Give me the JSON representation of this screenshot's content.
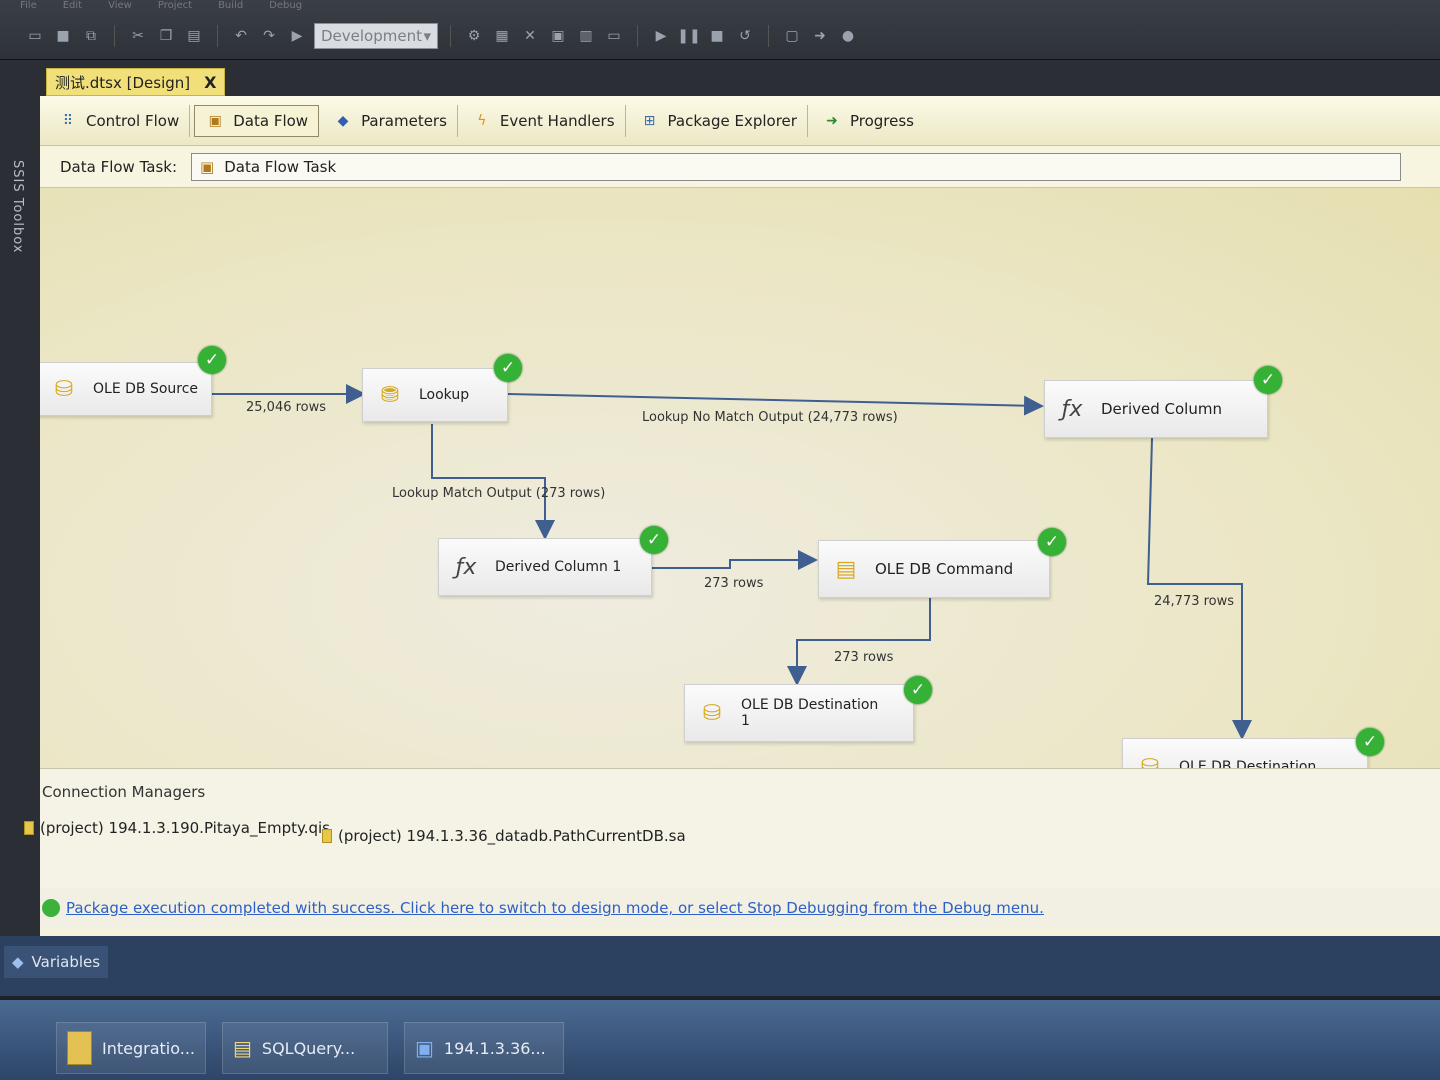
{
  "menu": [
    "File",
    "Edit",
    "View",
    "Project",
    "Build",
    "Debug"
  ],
  "toolbar": {
    "config": "Development"
  },
  "toolbox_label": "SSIS Toolbox",
  "doc_tab": {
    "title": "测试.dtsx [Design]",
    "close": "X"
  },
  "design_tabs": [
    {
      "label": "Control Flow",
      "icon": "control-flow-icon"
    },
    {
      "label": "Data Flow",
      "icon": "data-flow-icon"
    },
    {
      "label": "Parameters",
      "icon": "parameters-icon"
    },
    {
      "label": "Event Handlers",
      "icon": "event-handlers-icon"
    },
    {
      "label": "Package Explorer",
      "icon": "package-explorer-icon"
    },
    {
      "label": "Progress",
      "icon": "progress-icon"
    }
  ],
  "task": {
    "label": "Data Flow Task:",
    "value": "Data Flow Task"
  },
  "components": {
    "ole_db_source": "OLE DB Source",
    "lookup": "Lookup",
    "derived_column": "Derived Column",
    "derived_column_1": "Derived Column 1",
    "ole_db_command": "OLE DB Command",
    "ole_db_destination_1": "OLE DB Destination 1",
    "ole_db_destination": "OLE DB Destination"
  },
  "paths": {
    "source_to_lookup": "25,046 rows",
    "lookup_no_match": "Lookup No Match Output (24,773 rows)",
    "lookup_match": "Lookup Match Output (273 rows)",
    "dc1_to_command": "273 rows",
    "command_to_dest1": "273 rows",
    "dc_to_dest": "24,773 rows"
  },
  "connection_managers": {
    "title": "Connection Managers",
    "items": [
      "(project) 194.1.3.190.Pitaya_Empty.qis",
      "(project) 194.1.3.36_datadb.PathCurrentDB.sa"
    ]
  },
  "status": "Package execution completed with success. Click here to switch to design mode, or select Stop Debugging from the Debug menu.",
  "variables_tab": "Variables",
  "taskbar": [
    "Integratio...",
    "SQLQuery...",
    "194.1.3.36..."
  ]
}
